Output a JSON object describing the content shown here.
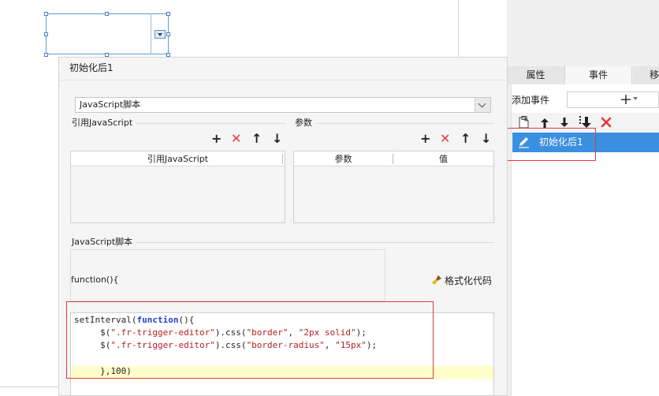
{
  "canvas": {
    "widget": "combo-box"
  },
  "right_panel": {
    "tabs": [
      "属性",
      "事件",
      "移"
    ],
    "active_tab": "事件",
    "add_event_label": "添加事件",
    "add_event_button": "+",
    "event_items": [
      "初始化后1"
    ],
    "toolbar_icons": [
      "document-icon",
      "arrow-up-icon",
      "arrow-down-icon",
      "move-down-icon",
      "delete-icon"
    ]
  },
  "dialog": {
    "title": "初始化后1",
    "type_select": "JavaScript脚本",
    "ref_section": {
      "label": "引用JavaScript",
      "column": "引用JavaScript"
    },
    "params_section": {
      "label": "参数",
      "columns": [
        "参数",
        "值"
      ]
    },
    "script_section": {
      "label": "JavaScript脚本"
    },
    "function_header": "function(){",
    "format_label": "格式化代码",
    "code_lines": [
      "setInterval(function(){",
      "     $(\".fr-trigger-editor\").css(\"border\", \"2px solid\");",
      "     $(\".fr-trigger-editor\").css(\"border-radius\", \"15px\");",
      "",
      "     },100)"
    ]
  },
  "colors": {
    "selection": "#3b8fe0",
    "highlight_box": "#e03c3c",
    "delete": "#e23a3a",
    "keyword": "#1f3fcf",
    "string": "#b52020",
    "current_line": "#ffffcc"
  }
}
